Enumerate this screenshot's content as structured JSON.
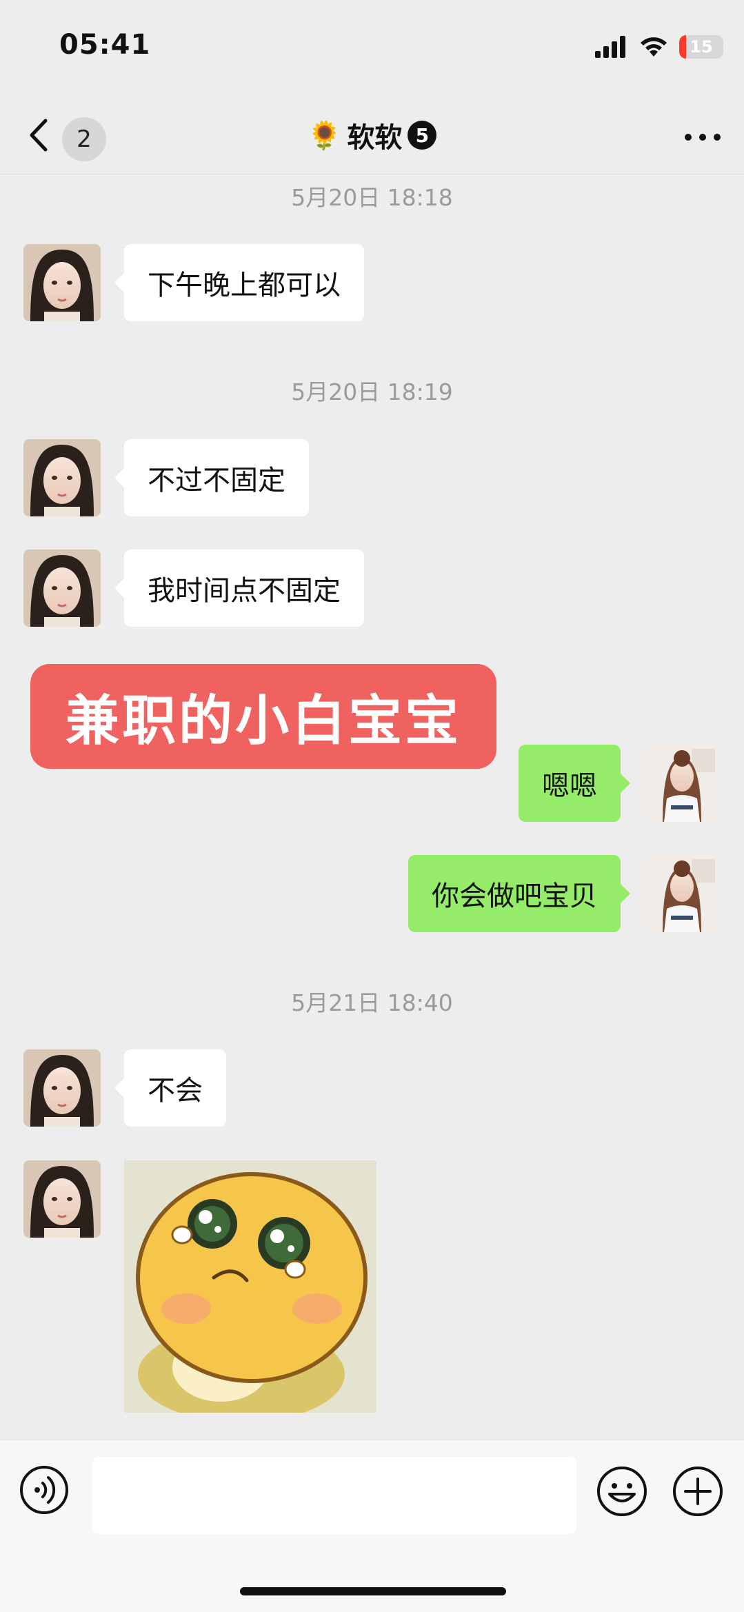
{
  "status_bar": {
    "time": "05:41",
    "battery": "15"
  },
  "header": {
    "back_count": "2",
    "title_emoji": "🌻",
    "title": "软软",
    "member_count": "5"
  },
  "timestamps": [
    "5月20日 18:18",
    "5月20日 18:19",
    "5月21日 18:40"
  ],
  "messages": [
    {
      "side": "in",
      "text": "下午晚上都可以"
    },
    {
      "side": "in",
      "text": "不过不固定"
    },
    {
      "side": "in",
      "text": "我时间点不固定"
    },
    {
      "side": "out",
      "text": "嗯嗯"
    },
    {
      "side": "out",
      "text": "你会做吧宝贝"
    },
    {
      "side": "in",
      "text": "不会"
    }
  ],
  "overlay_banner": "兼职的小白宝宝",
  "colors": {
    "incoming_bubble": "#ffffff",
    "outgoing_bubble": "#95ec69",
    "banner": "#f0625f",
    "background": "#ededed"
  },
  "icons": [
    "back-icon",
    "more-icon",
    "voice-icon",
    "emoji-icon",
    "plus-icon",
    "signal-icon",
    "wifi-icon",
    "battery-icon"
  ]
}
